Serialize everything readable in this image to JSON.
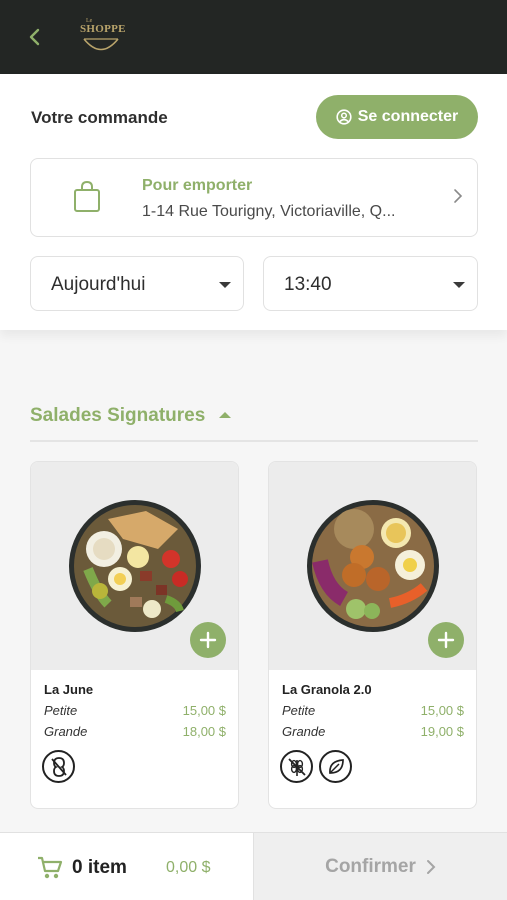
{
  "header": {
    "logo_small": "Le",
    "logo_text": "SHOPPE"
  },
  "order": {
    "title": "Votre commande",
    "connect_label": "Se connecter",
    "mode_label": "Pour emporter",
    "address": "1-14 Rue Tourigny, Victoriaville, Q...",
    "day": "Aujourd'hui",
    "time": "13:40"
  },
  "section": {
    "title": "Salades Signatures"
  },
  "products": [
    {
      "name": "La June",
      "sizes": [
        {
          "label": "Petite",
          "price": "15,00 $"
        },
        {
          "label": "Grande",
          "price": "18,00 $"
        }
      ],
      "icons": [
        "peanut-free-icon"
      ]
    },
    {
      "name": "La Granola 2.0",
      "sizes": [
        {
          "label": "Petite",
          "price": "15,00 $"
        },
        {
          "label": "Grande",
          "price": "19,00 $"
        }
      ],
      "icons": [
        "gluten-free-icon",
        "vegetarian-leaf-icon"
      ]
    }
  ],
  "cart": {
    "count_label": "0 item",
    "total": "0,00 $",
    "confirm_label": "Confirmer"
  },
  "colors": {
    "accent": "#8fb06a",
    "topbar": "#232624",
    "logo_gold": "#b9a46b"
  }
}
